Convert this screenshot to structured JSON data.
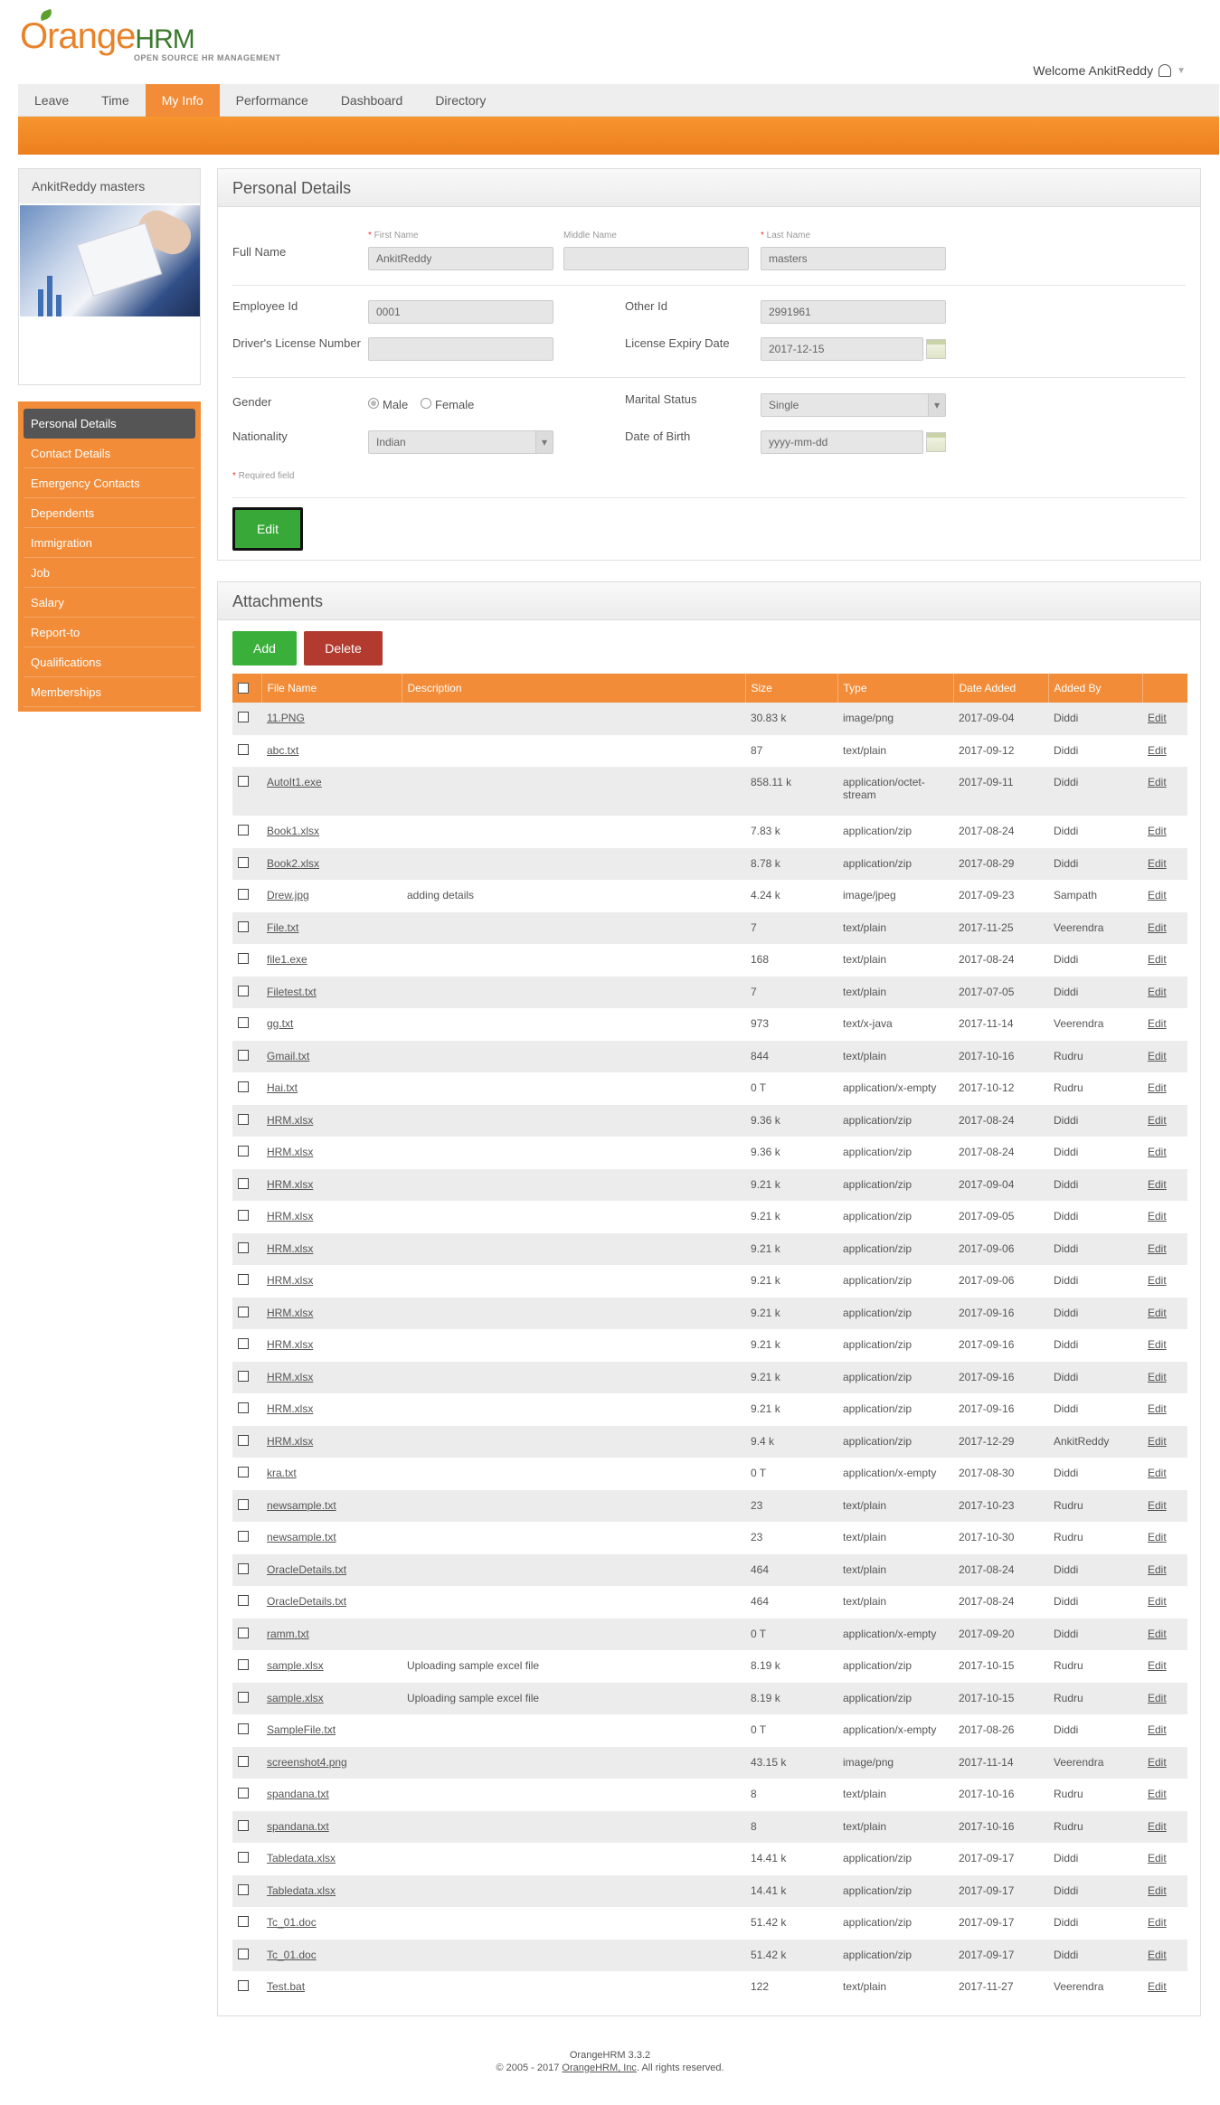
{
  "header": {
    "logo_main": "Orange",
    "logo_hrm": "HRM",
    "logo_tagline": "OPEN SOURCE HR MANAGEMENT",
    "welcome": "Welcome AnkitReddy"
  },
  "menu": [
    "Leave",
    "Time",
    "My Info",
    "Performance",
    "Dashboard",
    "Directory"
  ],
  "profile": {
    "name": "AnkitReddy masters"
  },
  "side_nav": [
    "Personal Details",
    "Contact Details",
    "Emergency Contacts",
    "Dependents",
    "Immigration",
    "Job",
    "Salary",
    "Report-to",
    "Qualifications",
    "Memberships"
  ],
  "personal": {
    "title": "Personal Details",
    "full_name_label": "Full Name",
    "first_name_label": "First Name",
    "middle_name_label": "Middle Name",
    "last_name_label": "Last Name",
    "first_name": "AnkitReddy",
    "middle_name": "",
    "last_name": "masters",
    "employee_id_label": "Employee Id",
    "employee_id": "0001",
    "other_id_label": "Other Id",
    "other_id": "2991961",
    "license_label": "Driver's License Number",
    "license": "",
    "license_expiry_label": "License Expiry Date",
    "license_expiry": "2017-12-15",
    "gender_label": "Gender",
    "gender_male": "Male",
    "gender_female": "Female",
    "marital_label": "Marital Status",
    "marital": "Single",
    "nationality_label": "Nationality",
    "nationality": "Indian",
    "dob_label": "Date of Birth",
    "dob_placeholder": "yyyy-mm-dd",
    "required_note": "Required field",
    "edit_button": "Edit"
  },
  "attachments": {
    "title": "Attachments",
    "add_button": "Add",
    "delete_button": "Delete",
    "columns": [
      "File Name",
      "Description",
      "Size",
      "Type",
      "Date Added",
      "Added By"
    ],
    "rows": [
      [
        "11.PNG",
        "",
        "30.83 k",
        "image/png",
        "2017-09-04",
        "Diddi",
        "Edit"
      ],
      [
        "abc.txt",
        "",
        "87",
        "text/plain",
        "2017-09-12",
        "Diddi",
        "Edit"
      ],
      [
        "AutoIt1.exe",
        "",
        "858.11 k",
        "application/octet-stream",
        "2017-09-11",
        "Diddi",
        "Edit"
      ],
      [
        "Book1.xlsx",
        "",
        "7.83 k",
        "application/zip",
        "2017-08-24",
        "Diddi",
        "Edit"
      ],
      [
        "Book2.xlsx",
        "",
        "8.78 k",
        "application/zip",
        "2017-08-29",
        "Diddi",
        "Edit"
      ],
      [
        "Drew.jpg",
        "adding details",
        "4.24 k",
        "image/jpeg",
        "2017-09-23",
        "Sampath",
        "Edit"
      ],
      [
        "File.txt",
        "",
        "7",
        "text/plain",
        "2017-11-25",
        "Veerendra",
        "Edit"
      ],
      [
        "file1.exe",
        "",
        "168",
        "text/plain",
        "2017-08-24",
        "Diddi",
        "Edit"
      ],
      [
        "Filetest.txt",
        "",
        "7",
        "text/plain",
        "2017-07-05",
        "Diddi",
        "Edit"
      ],
      [
        "gg.txt",
        "",
        "973",
        "text/x-java",
        "2017-11-14",
        "Veerendra",
        "Edit"
      ],
      [
        "Gmail.txt",
        "",
        "844",
        "text/plain",
        "2017-10-16",
        "Rudru",
        "Edit"
      ],
      [
        "Hai.txt",
        "",
        "0 T",
        "application/x-empty",
        "2017-10-12",
        "Rudru",
        "Edit"
      ],
      [
        "HRM.xlsx",
        "",
        "9.36 k",
        "application/zip",
        "2017-08-24",
        "Diddi",
        "Edit"
      ],
      [
        "HRM.xlsx",
        "",
        "9.36 k",
        "application/zip",
        "2017-08-24",
        "Diddi",
        "Edit"
      ],
      [
        "HRM.xlsx",
        "",
        "9.21 k",
        "application/zip",
        "2017-09-04",
        "Diddi",
        "Edit"
      ],
      [
        "HRM.xlsx",
        "",
        "9.21 k",
        "application/zip",
        "2017-09-05",
        "Diddi",
        "Edit"
      ],
      [
        "HRM.xlsx",
        "",
        "9.21 k",
        "application/zip",
        "2017-09-06",
        "Diddi",
        "Edit"
      ],
      [
        "HRM.xlsx",
        "",
        "9.21 k",
        "application/zip",
        "2017-09-06",
        "Diddi",
        "Edit"
      ],
      [
        "HRM.xlsx",
        "",
        "9.21 k",
        "application/zip",
        "2017-09-16",
        "Diddi",
        "Edit"
      ],
      [
        "HRM.xlsx",
        "",
        "9.21 k",
        "application/zip",
        "2017-09-16",
        "Diddi",
        "Edit"
      ],
      [
        "HRM.xlsx",
        "",
        "9.21 k",
        "application/zip",
        "2017-09-16",
        "Diddi",
        "Edit"
      ],
      [
        "HRM.xlsx",
        "",
        "9.21 k",
        "application/zip",
        "2017-09-16",
        "Diddi",
        "Edit"
      ],
      [
        "HRM.xlsx",
        "",
        "9.4 k",
        "application/zip",
        "2017-12-29",
        "AnkitReddy",
        "Edit"
      ],
      [
        "kra.txt",
        "",
        "0 T",
        "application/x-empty",
        "2017-08-30",
        "Diddi",
        "Edit"
      ],
      [
        "newsample.txt",
        "",
        "23",
        "text/plain",
        "2017-10-23",
        "Rudru",
        "Edit"
      ],
      [
        "newsample.txt",
        "",
        "23",
        "text/plain",
        "2017-10-30",
        "Rudru",
        "Edit"
      ],
      [
        "OracleDetails.txt",
        "",
        "464",
        "text/plain",
        "2017-08-24",
        "Diddi",
        "Edit"
      ],
      [
        "OracleDetails.txt",
        "",
        "464",
        "text/plain",
        "2017-08-24",
        "Diddi",
        "Edit"
      ],
      [
        "ramm.txt",
        "",
        "0 T",
        "application/x-empty",
        "2017-09-20",
        "Diddi",
        "Edit"
      ],
      [
        "sample.xlsx",
        "Uploading sample excel file",
        "8.19 k",
        "application/zip",
        "2017-10-15",
        "Rudru",
        "Edit"
      ],
      [
        "sample.xlsx",
        "Uploading sample excel file",
        "8.19 k",
        "application/zip",
        "2017-10-15",
        "Rudru",
        "Edit"
      ],
      [
        "SampleFile.txt",
        "",
        "0 T",
        "application/x-empty",
        "2017-08-26",
        "Diddi",
        "Edit"
      ],
      [
        "screenshot4.png",
        "",
        "43.15 k",
        "image/png",
        "2017-11-14",
        "Veerendra",
        "Edit"
      ],
      [
        "spandana.txt",
        "",
        "8",
        "text/plain",
        "2017-10-16",
        "Rudru",
        "Edit"
      ],
      [
        "spandana.txt",
        "",
        "8",
        "text/plain",
        "2017-10-16",
        "Rudru",
        "Edit"
      ],
      [
        "Tabledata.xlsx",
        "",
        "14.41 k",
        "application/zip",
        "2017-09-17",
        "Diddi",
        "Edit"
      ],
      [
        "Tabledata.xlsx",
        "",
        "14.41 k",
        "application/zip",
        "2017-09-17",
        "Diddi",
        "Edit"
      ],
      [
        "Tc_01.doc",
        "",
        "51.42 k",
        "application/zip",
        "2017-09-17",
        "Diddi",
        "Edit"
      ],
      [
        "Tc_01.doc",
        "",
        "51.42 k",
        "application/zip",
        "2017-09-17",
        "Diddi",
        "Edit"
      ],
      [
        "Test.bat",
        "",
        "122",
        "text/plain",
        "2017-11-27",
        "Veerendra",
        "Edit"
      ]
    ]
  },
  "footer": {
    "version": "OrangeHRM 3.3.2",
    "copyright_prefix": "© 2005 - 2017",
    "company_link": "OrangeHRM, Inc",
    "copyright_suffix": ". All rights reserved."
  }
}
